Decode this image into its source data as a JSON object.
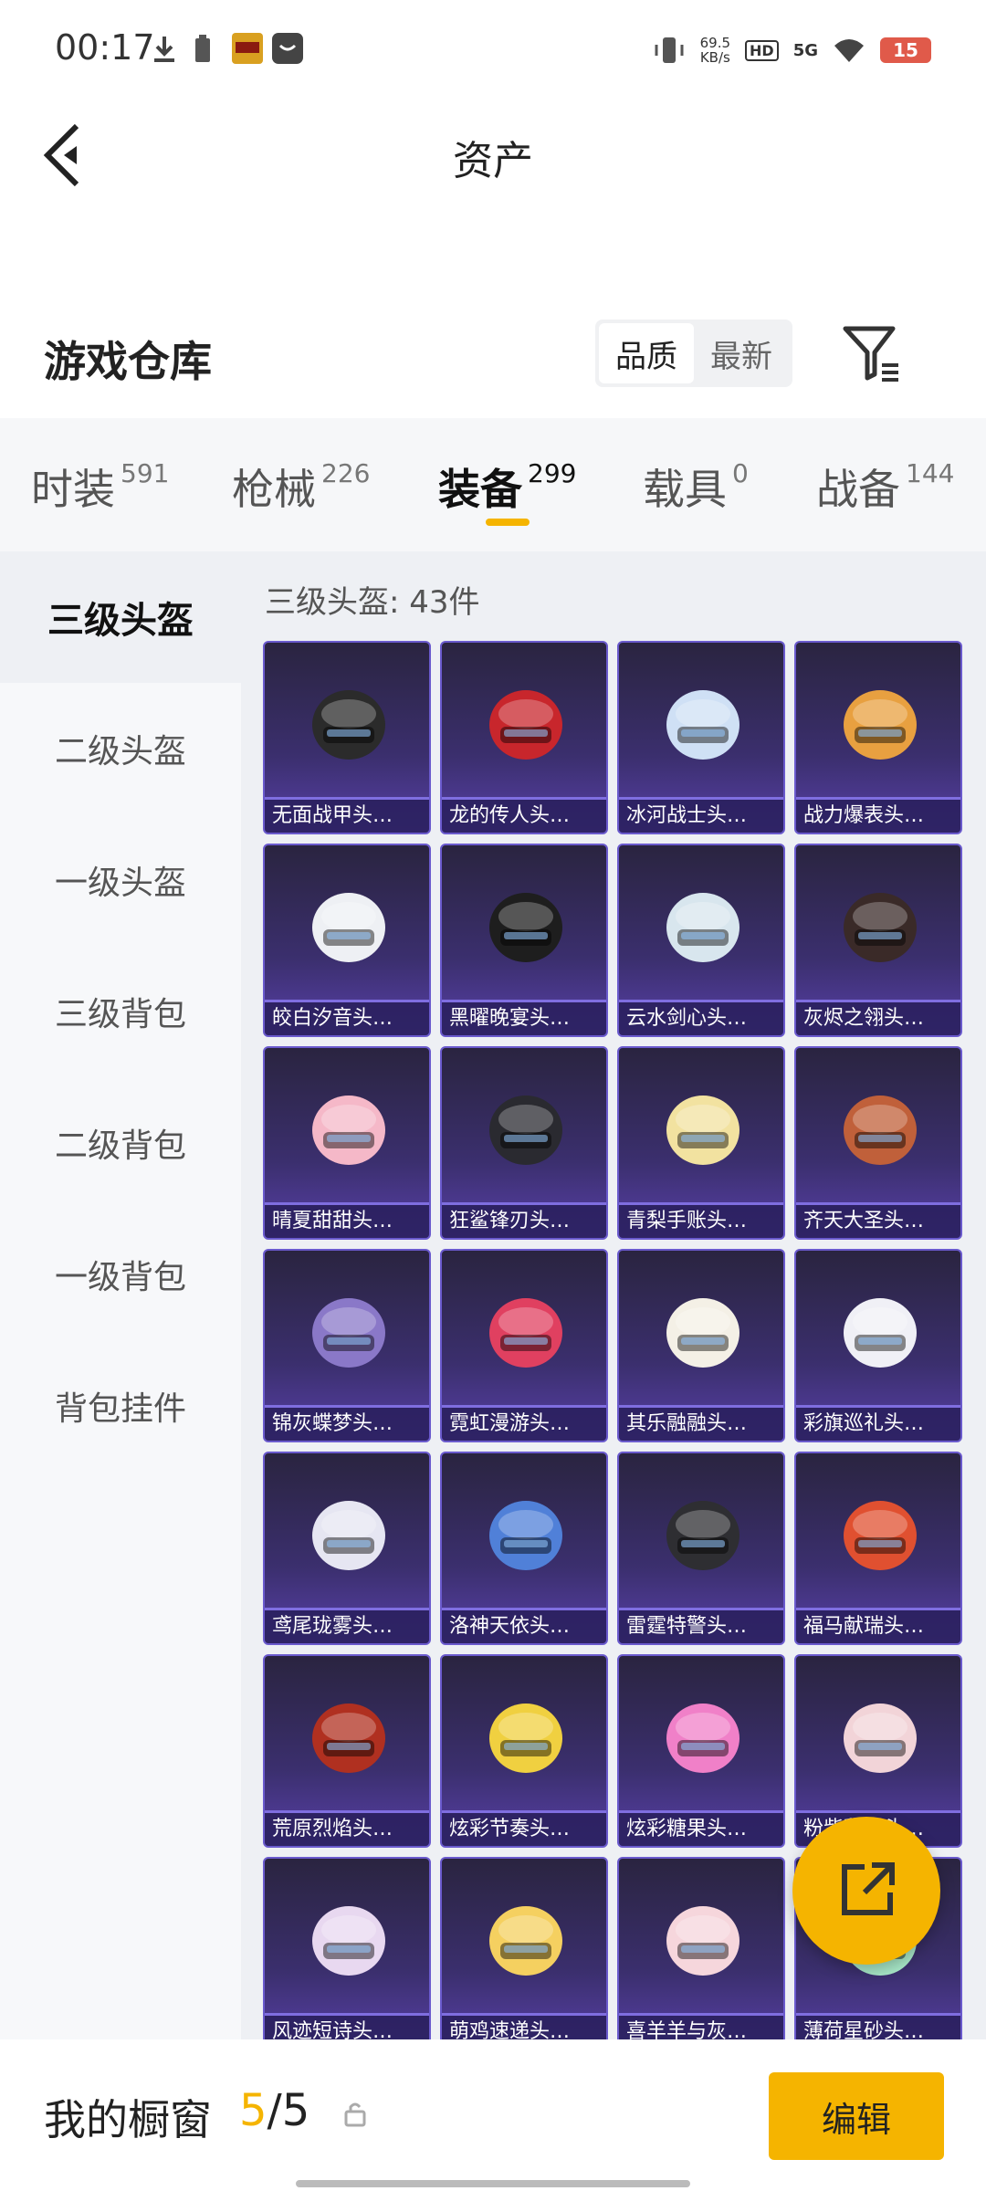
{
  "status_bar": {
    "time": "00:17",
    "net_speed_value": "69.5",
    "net_speed_unit": "KB/s",
    "hd": "HD",
    "network": "5G",
    "battery": "15"
  },
  "header": {
    "title": "资产"
  },
  "warehouse": {
    "title": "游戏仓库",
    "sort_options": [
      "品质",
      "最新"
    ],
    "active_sort": "品质"
  },
  "tabs": [
    {
      "label": "时装",
      "count": "591"
    },
    {
      "label": "枪械",
      "count": "226"
    },
    {
      "label": "装备",
      "count": "299"
    },
    {
      "label": "载具",
      "count": "0"
    },
    {
      "label": "战备",
      "count": "144"
    }
  ],
  "sidebar": {
    "items": [
      "三级头盔",
      "二级头盔",
      "一级头盔",
      "三级背包",
      "二级背包",
      "一级背包",
      "背包挂件"
    ]
  },
  "section": {
    "title": "三级头盔: 43件"
  },
  "items": [
    {
      "name": "无面战甲头…",
      "color": "#2b2b2b"
    },
    {
      "name": "龙的传人头…",
      "color": "#c8262c"
    },
    {
      "name": "冰河战士头…",
      "color": "#cfe0f5"
    },
    {
      "name": "战力爆表头…",
      "color": "#e8a040"
    },
    {
      "name": "皎白汐音头…",
      "color": "#eef0f4"
    },
    {
      "name": "黑曜晚宴头…",
      "color": "#1e1e1e"
    },
    {
      "name": "云水剑心头…",
      "color": "#d8e6ee"
    },
    {
      "name": "灰烬之翎头…",
      "color": "#3a2a28"
    },
    {
      "name": "晴夏甜甜头…",
      "color": "#f5b8c8"
    },
    {
      "name": "狂鲨锋刃头…",
      "color": "#2a2a30"
    },
    {
      "name": "青梨手账头…",
      "color": "#f2e2a0"
    },
    {
      "name": "齐天大圣头…",
      "color": "#c0603a"
    },
    {
      "name": "锦灰蝶梦头…",
      "color": "#8a78c8"
    },
    {
      "name": "霓虹漫游头…",
      "color": "#e04060"
    },
    {
      "name": "其乐融融头…",
      "color": "#f4f0e6"
    },
    {
      "name": "彩旗巡礼头…",
      "color": "#f0f0f6"
    },
    {
      "name": "鸢尾珑雾头…",
      "color": "#e6e6f2"
    },
    {
      "name": "洛神天依头…",
      "color": "#5080d8"
    },
    {
      "name": "雷霆特警头…",
      "color": "#2e2e32"
    },
    {
      "name": "福马献瑞头…",
      "color": "#e05030"
    },
    {
      "name": "荒原烈焰头…",
      "color": "#b03020"
    },
    {
      "name": "炫彩节奏头…",
      "color": "#f0d040"
    },
    {
      "name": "炫彩糖果头…",
      "color": "#f080c8"
    },
    {
      "name": "粉紫甜豆头…",
      "color": "#f2d4d8"
    },
    {
      "name": "风迹短诗头…",
      "color": "#e8d8f0"
    },
    {
      "name": "萌鸡速递头…",
      "color": "#f5d060"
    },
    {
      "name": "喜羊羊与灰…",
      "color": "#f6d6dc"
    },
    {
      "name": "薄荷星砂头…",
      "color": "#a8e8c8"
    }
  ],
  "showcase": {
    "label": "我的橱窗",
    "current": "5",
    "separator": "/",
    "total": "5",
    "edit_label": "编辑"
  },
  "colors": {
    "accent": "#f5b400"
  }
}
